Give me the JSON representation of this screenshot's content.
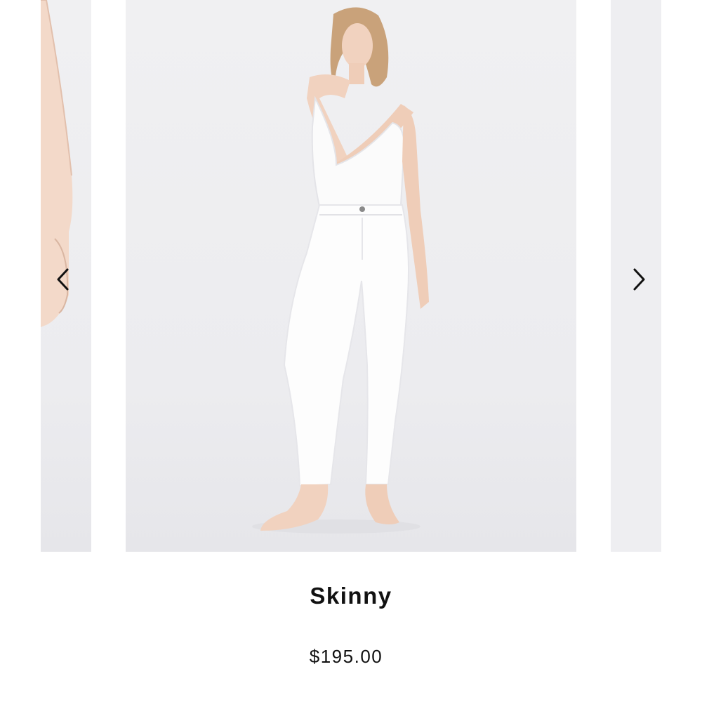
{
  "carousel": {
    "previous_icon": "chevron-left-icon",
    "next_icon": "chevron-right-icon",
    "main_image": "model-in-white-skinny-jeans"
  },
  "product": {
    "name": "Skinny",
    "price": "$195.00"
  },
  "colors": {
    "background": "#ffffff",
    "image_backdrop": "#eeeef1",
    "text": "#111111"
  }
}
